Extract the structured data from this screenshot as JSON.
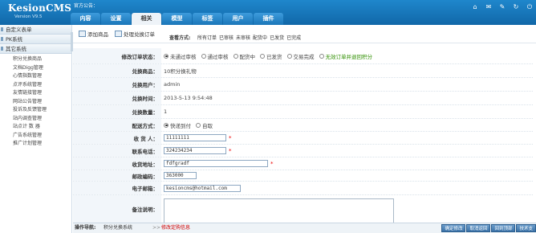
{
  "brand": {
    "logo": "KesionCMS",
    "version": "Version V9.5"
  },
  "header": {
    "notice": "官方公告：",
    "tabs": [
      "内容",
      "设置",
      "相关",
      "模型",
      "标签",
      "用户",
      "插件"
    ],
    "active_tab": "相关",
    "icons": [
      "home-icon",
      "mail-icon",
      "wrench-icon",
      "refresh-icon",
      "power-icon"
    ]
  },
  "sidebar": {
    "sections": [
      {
        "label": "自定义表单"
      },
      {
        "label": "PK系统"
      },
      {
        "label": "其它系统"
      }
    ],
    "items": [
      "积分兑换商品",
      "文档Digg管理",
      "心情指数管理",
      "点评系统管理",
      "友情链接管理",
      "网站公告管理",
      "投诉及反馈管理",
      "站内调查管理",
      "站点计 数 器",
      "广告系统管理",
      "推广计划管理"
    ]
  },
  "toolbar": {
    "add_label": "添加商品",
    "process_label": "处理兑换订单",
    "view_label": "查看方式:",
    "view_links": [
      "所有订单",
      "已审核",
      "未审核",
      "配货中",
      "已发货",
      "已完成"
    ]
  },
  "form": {
    "status_label": "修改订单状态：",
    "status_options": [
      "未通过审核",
      "通过审核",
      "配货中",
      "已发货",
      "交易完成"
    ],
    "status_extra": "无效订单并退回积分",
    "product_label": "兑换商品：",
    "product_value": "10积分换礼物",
    "user_label": "兑换用户：",
    "user_value": "admin",
    "time_label": "兑换时间：",
    "time_value": "2013-5-13 9:54:48",
    "qty_label": "兑换数量：",
    "qty_value": "1",
    "delivery_label": "配送方式：",
    "delivery_options": [
      "快递到付",
      "自取"
    ],
    "receiver_label": "收 货 人：",
    "receiver_value": "11111111",
    "phone_label": "联系电话：",
    "phone_value": "324234234",
    "address_label": "收货地址：",
    "address_value": "fdfgradf",
    "zip_label": "邮政编码：",
    "zip_value": "363000",
    "email_label": "电子邮箱：",
    "email_value": "kesioncms@hotmail.com",
    "remark_label": "备注说明："
  },
  "statusbar": {
    "nav_label": "操作导航:",
    "nav_link": "积分兑换系统",
    "nav_sep": ">>",
    "nav_current": "修改定购信息",
    "buttons": [
      "确定修改",
      "取消返回",
      "回到顶部",
      "技术支"
    ]
  },
  "colors": {
    "header_blue": "#1a78bd",
    "required": "#e00000",
    "valid": "#2f8f00"
  }
}
